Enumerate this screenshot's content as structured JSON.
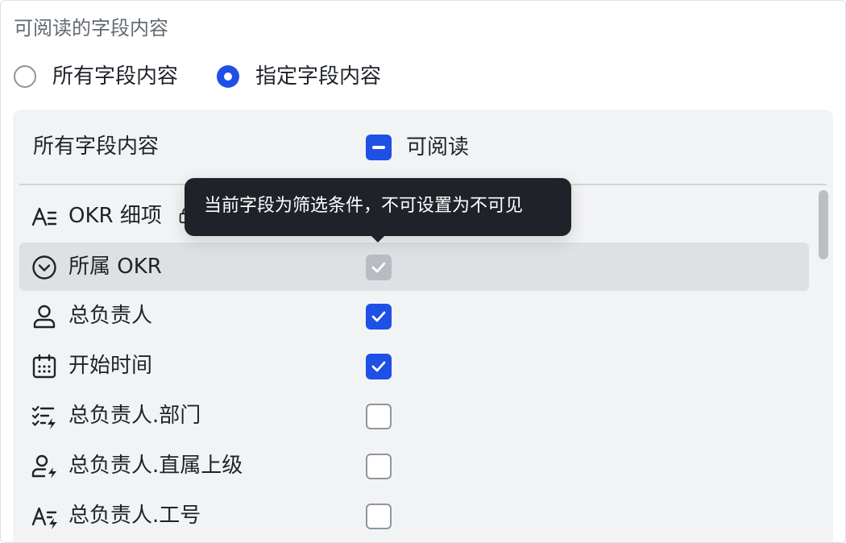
{
  "section_title": "可阅读的字段内容",
  "mode_options": [
    {
      "label": "所有字段内容",
      "checked": false
    },
    {
      "label": "指定字段内容",
      "checked": true
    }
  ],
  "panel": {
    "header_label": "所有字段内容",
    "header_checkbox_label": "可阅读",
    "header_checkbox_state": "indeterminate"
  },
  "fields": [
    {
      "label": "OKR 细项",
      "icon": "text-field-icon",
      "state": "hidden-by-tooltip",
      "locked": true
    },
    {
      "label": "所属 OKR",
      "icon": "single-select-icon",
      "state": "checked-disabled"
    },
    {
      "label": "总负责人",
      "icon": "person-icon",
      "state": "checked"
    },
    {
      "label": "开始时间",
      "icon": "calendar-icon",
      "state": "checked"
    },
    {
      "label": "总负责人.部门",
      "icon": "lookup-list-icon",
      "state": "unchecked"
    },
    {
      "label": "总负责人.直属上级",
      "icon": "lookup-person-icon",
      "state": "unchecked"
    },
    {
      "label": "总负责人.工号",
      "icon": "lookup-text-icon",
      "state": "unchecked"
    }
  ],
  "tooltip": {
    "text": "当前字段为筛选条件，不可设置为不可见"
  },
  "colors": {
    "accent": "#1e50e6",
    "panel_bg": "#f2f3f5",
    "tooltip_bg": "#1f2329",
    "disabled_check": "#b8bcc2"
  }
}
